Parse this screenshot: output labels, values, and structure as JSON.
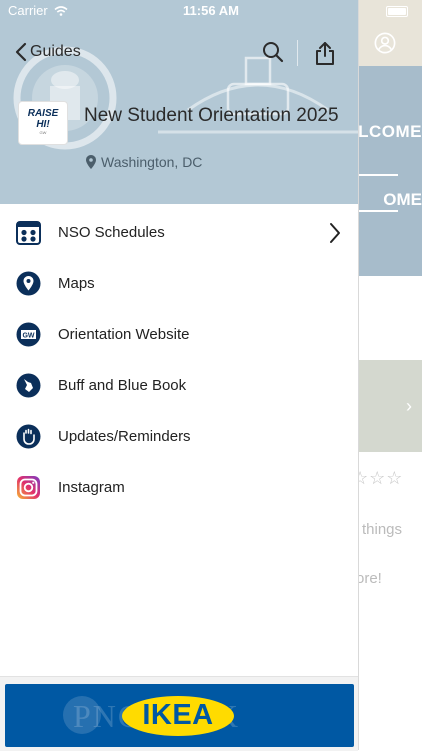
{
  "status": {
    "carrier": "Carrier",
    "time": "11:56 AM"
  },
  "header": {
    "back_label": "Guides",
    "title": "New Student Orientation 2025",
    "location": "Washington, DC",
    "logo": {
      "line1": "RAISE",
      "line2": "HI!",
      "small": "GW"
    }
  },
  "menu": {
    "items": [
      {
        "label": "NSO Schedules",
        "icon": "calendar-grid-icon"
      },
      {
        "label": "Maps",
        "icon": "map-pin-icon"
      },
      {
        "label": "Orientation Website",
        "icon": "gw-logo-icon"
      },
      {
        "label": "Buff and Blue Book",
        "icon": "hand-gesture-icon"
      },
      {
        "label": "Updates/Reminders",
        "icon": "waving-hand-icon"
      },
      {
        "label": "Instagram",
        "icon": "instagram-icon"
      }
    ]
  },
  "background": {
    "banner_line1": "WEEKS OF WELCOME",
    "banner_line2": "OME",
    "text1": "things",
    "text2": "ore!",
    "stars": "☆☆☆"
  },
  "ad": {
    "brand": "IKEA",
    "ghost_text": "PNCBANK"
  },
  "colors": {
    "header_bg": "#b3c8d5",
    "accent": "#0b2f5a",
    "ikea_blue": "#0058a3",
    "ikea_yellow": "#ffdb00"
  }
}
